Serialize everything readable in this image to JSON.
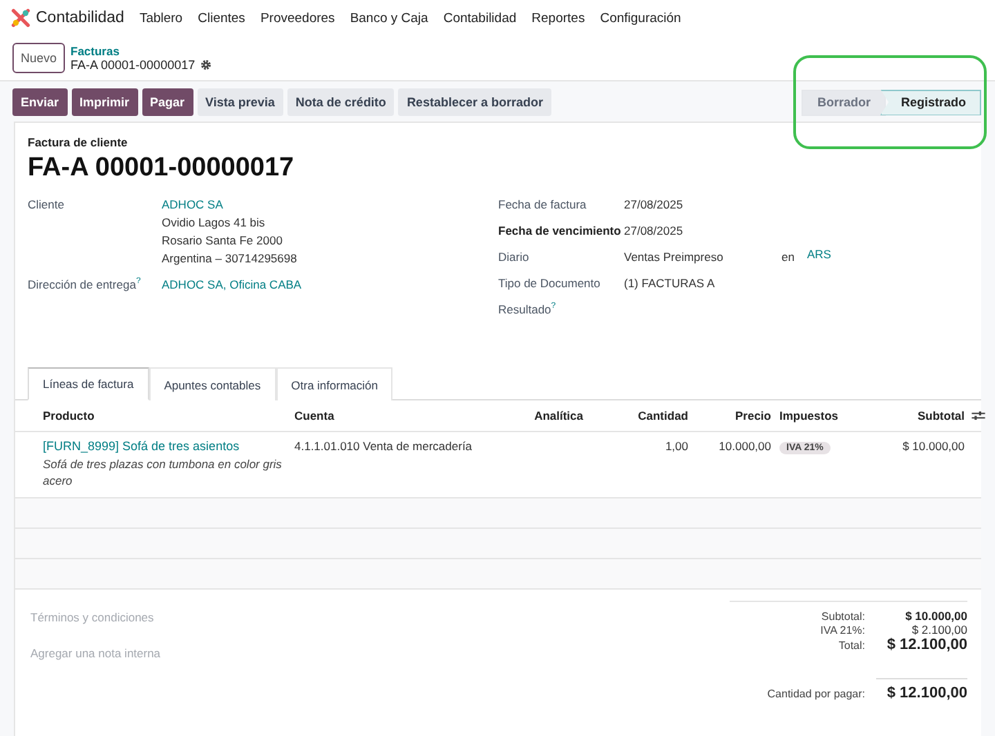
{
  "app": {
    "name": "Contabilidad",
    "menu": [
      "Tablero",
      "Clientes",
      "Proveedores",
      "Banco y Caja",
      "Contabilidad",
      "Reportes",
      "Configuración"
    ]
  },
  "breadcrumb": {
    "new_button": "Nuevo",
    "parent": "Facturas",
    "current": "FA-A 00001-00000017"
  },
  "actions": [
    {
      "label": "Enviar",
      "kind": "primary"
    },
    {
      "label": "Imprimir",
      "kind": "primary"
    },
    {
      "label": "Pagar",
      "kind": "primary"
    },
    {
      "label": "Vista previa",
      "kind": "secondary"
    },
    {
      "label": "Nota de crédito",
      "kind": "secondary"
    },
    {
      "label": "Restablecer a borrador",
      "kind": "secondary"
    }
  ],
  "status": [
    {
      "label": "Borrador",
      "selected": false
    },
    {
      "label": "Registrado",
      "selected": true
    }
  ],
  "form": {
    "type_label": "Factura de cliente",
    "number": "FA-A 00001-00000017",
    "left": [
      {
        "label": "Cliente",
        "values": [
          {
            "text": "ADHOC SA",
            "link": true
          },
          {
            "text": "Ovidio Lagos 41 bis",
            "link": false
          },
          {
            "text": "Rosario Santa Fe 2000",
            "link": false
          },
          {
            "text": "Argentina – 30714295698",
            "link": false
          }
        ]
      },
      {
        "label": "Dirección de entrega",
        "help": "?",
        "values": [
          {
            "text": "ADHOC SA, Oficina CABA",
            "link": true
          }
        ]
      }
    ],
    "right": [
      {
        "label": "Fecha de factura",
        "bold": false,
        "value": "27/08/2025"
      },
      {
        "label": "Fecha de vencimiento",
        "bold": true,
        "value": "27/08/2025"
      },
      {
        "label": "Diario",
        "bold": false,
        "value": "Ventas Preimpreso",
        "joiner": "en",
        "link": "ARS"
      },
      {
        "label": "Tipo de Documento",
        "bold": false,
        "value": "(1) FACTURAS A"
      },
      {
        "label": "Resultado",
        "bold": false,
        "help": "?"
      }
    ]
  },
  "tabs": [
    {
      "label": "Líneas de factura",
      "selected": true
    },
    {
      "label": "Apuntes contables",
      "selected": false
    },
    {
      "label": "Otra información",
      "selected": false
    }
  ],
  "table": {
    "columns": [
      "Producto",
      "Cuenta",
      "Analítica",
      "Cantidad",
      "Precio",
      "Impuestos",
      "Subtotal"
    ],
    "rows": [
      {
        "product": "[FURN_8999] Sofá de tres asientos",
        "description": "Sofá de tres plazas con tumbona en color gris acero",
        "account": "4.1.1.01.010 Venta de mercadería",
        "quantity": "1,00",
        "price": "10.000,00",
        "tax": "IVA 21%",
        "subtotal": "$ 10.000,00"
      }
    ]
  },
  "notes": {
    "terms_placeholder": "Términos y condiciones",
    "internal_placeholder": "Agregar una nota interna"
  },
  "totals": [
    {
      "label": "Subtotal:",
      "value": "$ 10.000,00",
      "kind": "subtotal"
    },
    {
      "label": "IVA 21%:",
      "value": "$ 2.100,00",
      "kind": "tax"
    },
    {
      "label": "Total:",
      "value": "$ 12.100,00",
      "kind": "total"
    }
  ],
  "amount_due": {
    "label": "Cantidad por pagar:",
    "value": "$ 12.100,00"
  }
}
